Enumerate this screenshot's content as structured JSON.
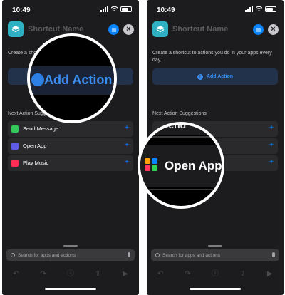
{
  "status": {
    "time": "10:49"
  },
  "header": {
    "title": "Shortcut Name",
    "close_symbol": "×"
  },
  "description": "Create a shortcut to actions you do in your apps every day.",
  "description_left": "Create a shor… apps every day.",
  "add_action": {
    "label": "Add Action",
    "icon": "plus-circle-icon"
  },
  "suggestions": {
    "title": "Next Action Suggestions",
    "title_left": "Next Action Suggest…",
    "items": [
      {
        "label": "Send Message",
        "icon": "message-icon",
        "color": "#34c759"
      },
      {
        "label": "Open App",
        "icon": "app-grid-icon",
        "color": "#5e5ce6"
      },
      {
        "label": "Play Music",
        "icon": "music-icon",
        "color": "#ff2d55"
      }
    ]
  },
  "search": {
    "placeholder": "Search for apps and actions"
  },
  "magnifier_left": {
    "text": "Add Action"
  },
  "magnifier_right": {
    "top_text": "Send",
    "text": "Open App"
  },
  "colors": {
    "accent": "#0a84ff",
    "background": "#1c1c1e",
    "row": "#2a2a2d",
    "add_button": "#22324a"
  }
}
